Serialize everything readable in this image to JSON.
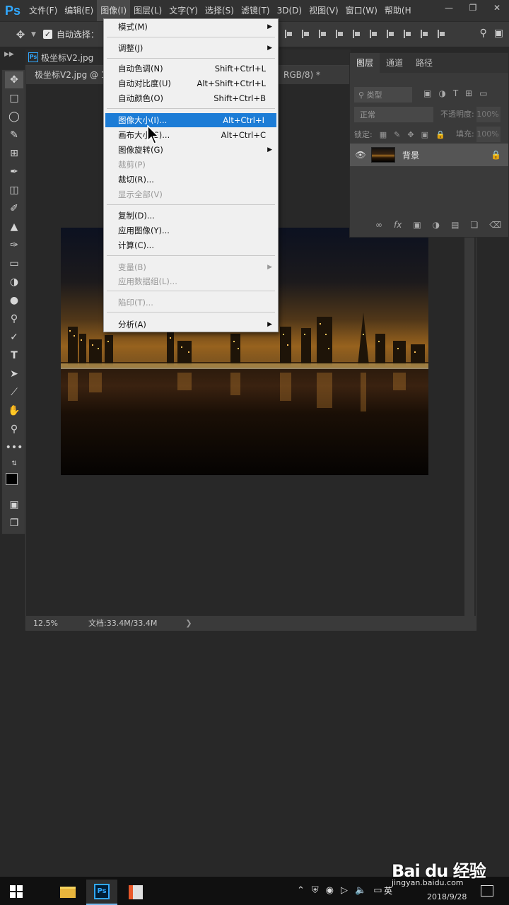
{
  "app": {
    "logo": "Ps",
    "menus": [
      "文件(F)",
      "编辑(E)",
      "图像(I)",
      "图层(L)",
      "文字(Y)",
      "选择(S)",
      "滤镜(T)",
      "3D(D)",
      "视图(V)",
      "窗口(W)",
      "帮助(H"
    ],
    "active_menu_index": 2
  },
  "options_bar": {
    "auto_select_label": "自动选择："
  },
  "document": {
    "tab_title": "极坐标V2.jpg",
    "subtab_title": "极坐标V2.jpg @ 1",
    "subtab_suffix": "RGB/8) *",
    "zoom": "12.5%",
    "doc_info": "文档:33.4M/33.4M"
  },
  "image_menu": {
    "items": [
      {
        "label": "模式(M)",
        "shortcut": "",
        "submenu": true,
        "disabled": false
      },
      {
        "label": "调整(J)",
        "shortcut": "",
        "submenu": true,
        "disabled": false
      },
      {
        "label": "自动色调(N)",
        "shortcut": "Shift+Ctrl+L",
        "submenu": false,
        "disabled": false
      },
      {
        "label": "自动对比度(U)",
        "shortcut": "Alt+Shift+Ctrl+L",
        "submenu": false,
        "disabled": false
      },
      {
        "label": "自动颜色(O)",
        "shortcut": "Shift+Ctrl+B",
        "submenu": false,
        "disabled": false
      },
      {
        "label": "图像大小(I)...",
        "shortcut": "Alt+Ctrl+I",
        "submenu": false,
        "disabled": false,
        "highlighted": true
      },
      {
        "label": "画布大小(S)...",
        "shortcut": "Alt+Ctrl+C",
        "submenu": false,
        "disabled": false
      },
      {
        "label": "图像旋转(G)",
        "shortcut": "",
        "submenu": true,
        "disabled": false
      },
      {
        "label": "裁剪(P)",
        "shortcut": "",
        "submenu": false,
        "disabled": true
      },
      {
        "label": "裁切(R)...",
        "shortcut": "",
        "submenu": false,
        "disabled": false
      },
      {
        "label": "显示全部(V)",
        "shortcut": "",
        "submenu": false,
        "disabled": true
      },
      {
        "label": "复制(D)...",
        "shortcut": "",
        "submenu": false,
        "disabled": false
      },
      {
        "label": "应用图像(Y)...",
        "shortcut": "",
        "submenu": false,
        "disabled": false
      },
      {
        "label": "计算(C)...",
        "shortcut": "",
        "submenu": false,
        "disabled": false
      },
      {
        "label": "变量(B)",
        "shortcut": "",
        "submenu": true,
        "disabled": true
      },
      {
        "label": "应用数据组(L)...",
        "shortcut": "",
        "submenu": false,
        "disabled": true
      },
      {
        "label": "陷印(T)...",
        "shortcut": "",
        "submenu": false,
        "disabled": true
      },
      {
        "label": "分析(A)",
        "shortcut": "",
        "submenu": true,
        "disabled": false
      }
    ]
  },
  "layers_panel": {
    "tabs": [
      "图层",
      "通道",
      "路径"
    ],
    "active_tab_index": 0,
    "filter_placeholder": "类型",
    "blend_mode": "正常",
    "opacity_label": "不透明度:",
    "opacity_value": "100%",
    "lock_label": "锁定:",
    "fill_label": "填充:",
    "fill_value": "100%",
    "layer_name": "背景"
  },
  "taskbar": {
    "ime": "英",
    "date": "2018/9/28"
  },
  "watermark": {
    "brand": "Bai du 经验",
    "url": "jingyan.baidu.com"
  },
  "colors": {
    "menu_highlight": "#1c7cd6",
    "ps_blue": "#31a8ff",
    "foreground": "#000000",
    "background": "#ffffff"
  }
}
